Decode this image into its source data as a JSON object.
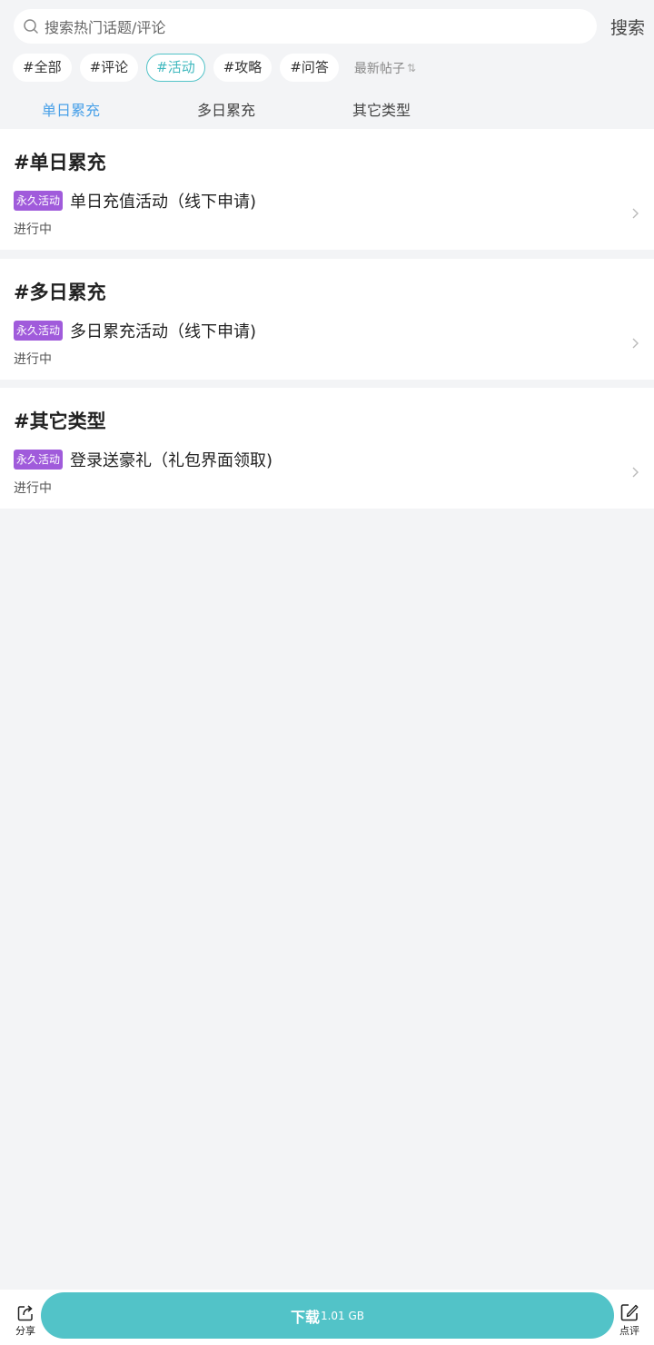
{
  "search": {
    "placeholder": "搜索热门话题/评论",
    "button_label": "搜索"
  },
  "chips": [
    {
      "label": "#全部",
      "active": false
    },
    {
      "label": "#评论",
      "active": false
    },
    {
      "label": "#活动",
      "active": true
    },
    {
      "label": "#攻略",
      "active": false
    },
    {
      "label": "#问答",
      "active": false
    }
  ],
  "sort": {
    "label": "最新帖子",
    "icon": "sort-arrows-icon"
  },
  "tabs": [
    {
      "label": "单日累充",
      "active": true
    },
    {
      "label": "多日累充",
      "active": false
    },
    {
      "label": "其它类型",
      "active": false
    }
  ],
  "sections": [
    {
      "heading": "#单日累充",
      "item": {
        "badge": "永久活动",
        "title": "单日充值活动（线下申请)",
        "status": "进行中"
      }
    },
    {
      "heading": "#多日累充",
      "item": {
        "badge": "永久活动",
        "title": "多日累充活动（线下申请)",
        "status": "进行中"
      }
    },
    {
      "heading": "#其它类型",
      "item": {
        "badge": "永久活动",
        "title": "登录送豪礼（礼包界面领取)",
        "status": "进行中"
      }
    }
  ],
  "bottom_bar": {
    "share_label": "分享",
    "download_label": "下载",
    "download_size": "1.01 GB",
    "review_label": "点评"
  },
  "colors": {
    "accent": "#52c3c8",
    "tab_active": "#4aa1e8",
    "badge": "#a05bdb",
    "background": "#f3f4f6"
  }
}
